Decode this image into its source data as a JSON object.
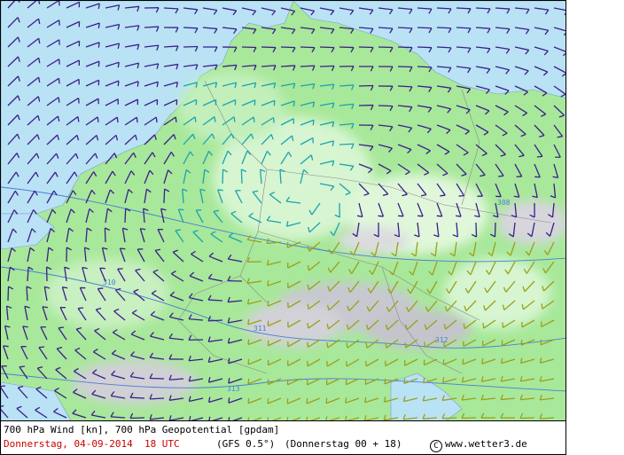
{
  "caption": {
    "title": "700 hPa Wind [kn], 700 hPa Geopotential [gpdam]",
    "date": "Donnerstag, 04-09-2014  18 UTC",
    "model": "(GFS 0.5°)",
    "run": "(Donnerstag 00 + 18)",
    "copyright_symbol": "C",
    "source": "www.wetter3.de"
  },
  "contour_labels": [
    "310",
    "311",
    "312",
    "313",
    "308"
  ],
  "colors": {
    "land_green": "#a8e89a",
    "sea_blue": "#b9e2f5",
    "barb_purple": "#3a1f8a",
    "barb_teal": "#1aa3b0",
    "barb_olive": "#9aa01a",
    "contour_blue": "#4a7fd6",
    "date_red": "#cc0000"
  },
  "legend_icons": [
    "wind-barb-icon"
  ]
}
